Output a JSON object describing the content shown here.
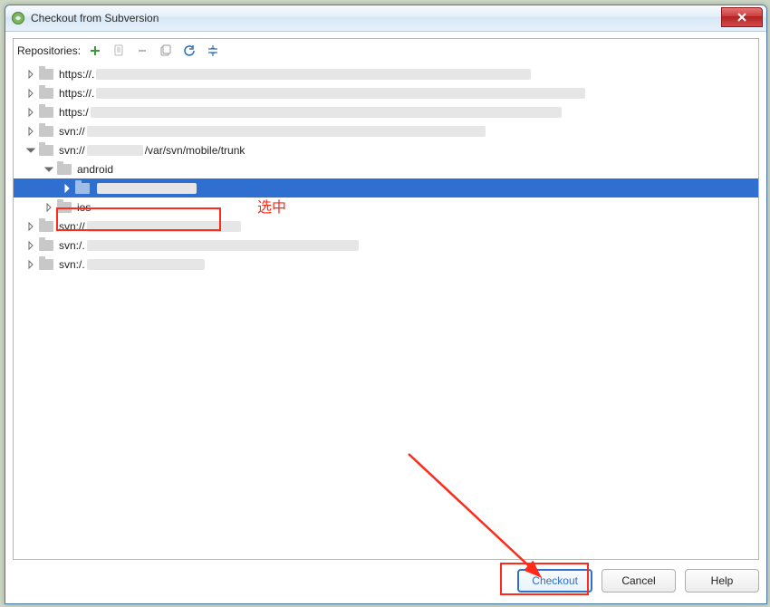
{
  "window": {
    "title": "Checkout from Subversion"
  },
  "toolbar": {
    "label": "Repositories:"
  },
  "icons": {
    "add": "add-icon",
    "edit": "edit-icon",
    "remove": "remove-icon",
    "copy": "copy-icon",
    "refresh": "refresh-icon",
    "collapse": "collapse-icon"
  },
  "tree": {
    "rows": [
      {
        "indent": 0,
        "expanded": false,
        "label": "https://.",
        "blur": 480
      },
      {
        "indent": 0,
        "expanded": false,
        "label": "https://.",
        "blur": 540
      },
      {
        "indent": 0,
        "expanded": false,
        "label": "https:/",
        "blur": 520
      },
      {
        "indent": 0,
        "expanded": false,
        "label": "svn://",
        "blur": 440
      },
      {
        "indent": 0,
        "expanded": true,
        "label": "svn://",
        "mid_blur": 62,
        "tail": "/var/svn/mobile/trunk"
      },
      {
        "indent": 1,
        "expanded": true,
        "label": "android"
      },
      {
        "indent": 2,
        "expanded": false,
        "label": "",
        "blur": 110,
        "selected": true
      },
      {
        "indent": 1,
        "expanded": false,
        "label": "ios"
      },
      {
        "indent": 0,
        "expanded": false,
        "label": "svn://",
        "blur": 170
      },
      {
        "indent": 0,
        "expanded": false,
        "label": "svn:/.",
        "blur": 300
      },
      {
        "indent": 0,
        "expanded": false,
        "label": "svn:/.",
        "blur": 130
      }
    ]
  },
  "buttons": {
    "checkout": "Checkout",
    "cancel": "Cancel",
    "help": "Help"
  },
  "annotations": {
    "selected_label": "选中"
  }
}
